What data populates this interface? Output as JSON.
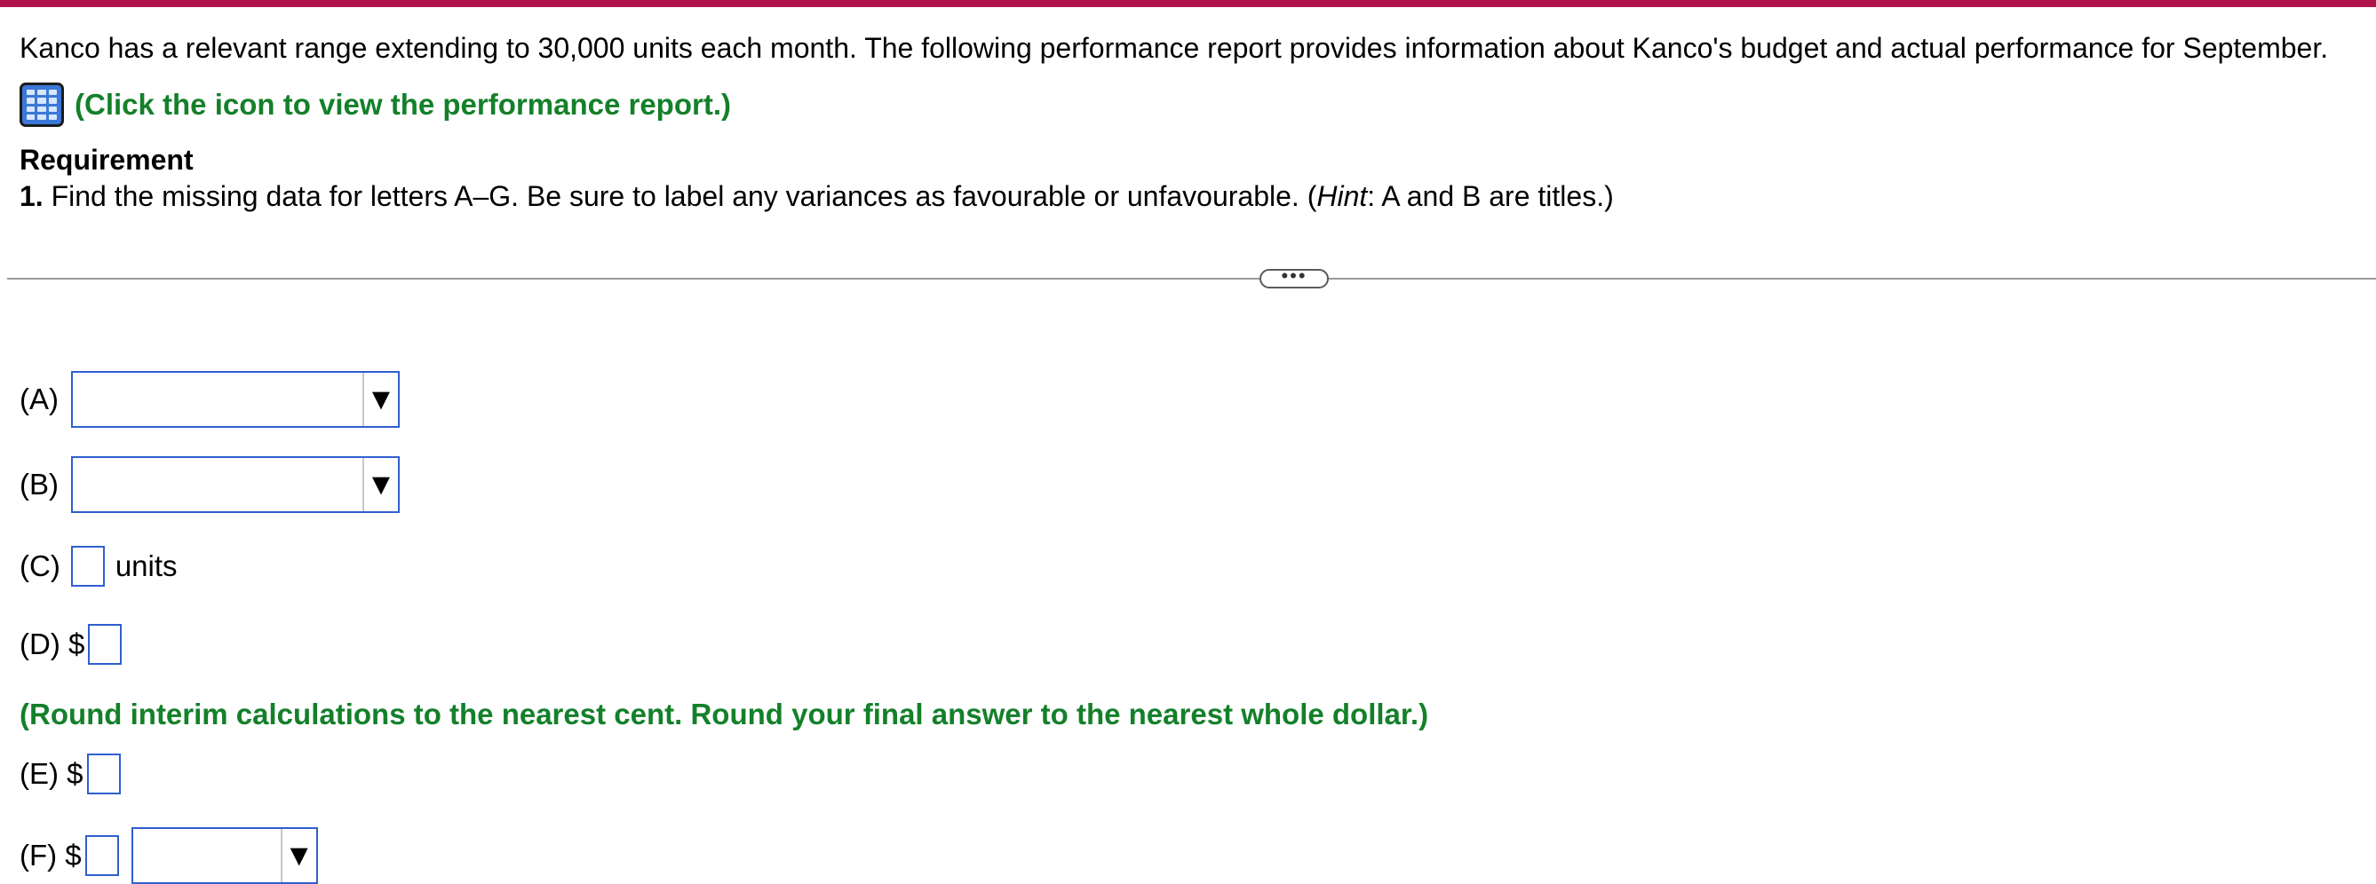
{
  "question": {
    "intro": "Kanco has a relevant range extending to 30,000 units each month. The following performance report provides information about Kanco's budget and actual performance for September.",
    "report_link": "(Click the icon to view the performance report.)",
    "requirement_title": "Requirement",
    "requirement_number": "1.",
    "requirement_text_1": " Find the missing data for letters A–G. Be sure to label any variances as favourable or unfavourable. (",
    "requirement_hint": "Hint",
    "requirement_text_2": ": A and B are titles.)"
  },
  "toggle": {
    "label": "•••"
  },
  "answers": {
    "a_label": "(A)",
    "b_label": "(B)",
    "c_label": "(C)",
    "c_units": "units",
    "d_label": "(D) $",
    "round_note": "(Round interim calculations to the nearest cent. Round your final answer to the nearest whole dollar.)",
    "e_label": "(E) $",
    "f_label": "(F) $",
    "dropdown_arrow": "▼"
  },
  "colors": {
    "accent_bar": "#b0124a",
    "instruction_green": "#14802a",
    "input_border": "#2f5fd0"
  },
  "icons": {
    "report": "spreadsheet-grid-icon",
    "dropdown": "dropdown-arrow-icon"
  }
}
